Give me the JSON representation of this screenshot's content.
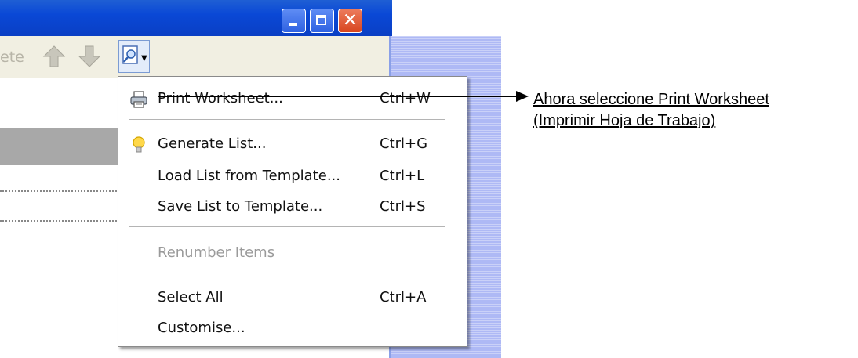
{
  "toolbar": {
    "delete_label": "ete",
    "up_icon": "arrow-up-icon",
    "down_icon": "arrow-down-icon",
    "print_preview_icon": "print-preview-icon"
  },
  "window_buttons": {
    "minimize_icon": "minimize-icon",
    "maximize_icon": "maximize-icon",
    "close_glyph": "✕"
  },
  "menu": {
    "items": [
      {
        "label": "Print Worksheet...",
        "shortcut": "Ctrl+W",
        "icon": "printer-icon",
        "enabled": true
      },
      {
        "label": "Generate List...",
        "shortcut": "Ctrl+G",
        "icon": "lightbulb-icon",
        "enabled": true
      },
      {
        "label": "Load List from Template...",
        "shortcut": "Ctrl+L",
        "enabled": true
      },
      {
        "label": "Save List to Template...",
        "shortcut": "Ctrl+S",
        "enabled": true
      },
      {
        "label": "Renumber Items",
        "shortcut": "",
        "enabled": false
      },
      {
        "label": "Select All",
        "shortcut": "Ctrl+A",
        "enabled": true
      },
      {
        "label": "Customise...",
        "shortcut": "",
        "enabled": true
      }
    ]
  },
  "annotation": {
    "line1": "Ahora seleccione Print Worksheet",
    "line2": "(Imprimir Hoja de Trabajo)"
  },
  "colors": {
    "titlebar": "#0a48d6",
    "menu_bg": "#ffffff",
    "strip": "#aeb9f5",
    "disabled_text": "#9a9a9a"
  }
}
